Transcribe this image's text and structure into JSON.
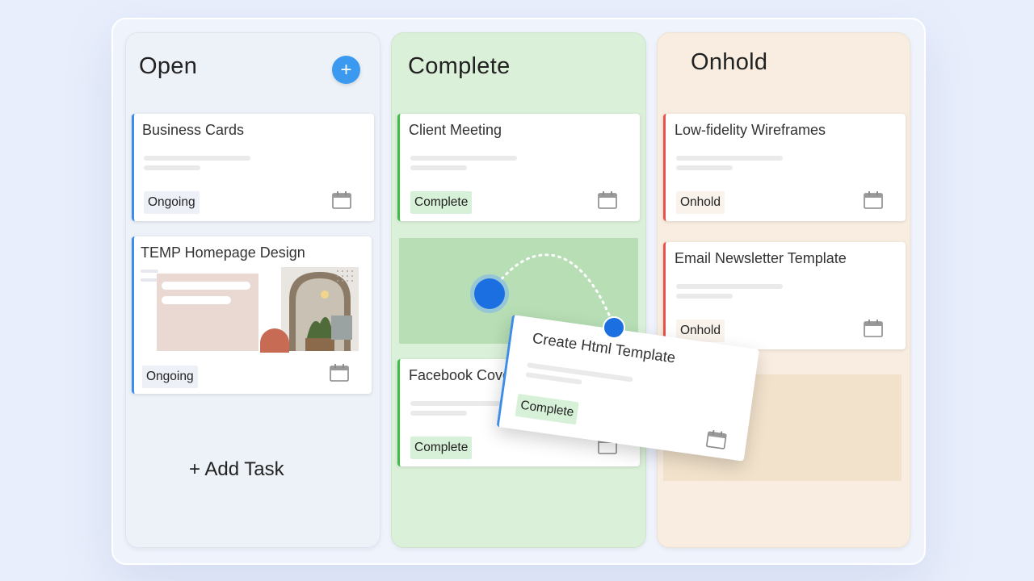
{
  "columns": {
    "open": {
      "title": "Open",
      "add_icon": "plus-icon",
      "add_task_label": "+ Add Task"
    },
    "complete": {
      "title": "Complete"
    },
    "onhold": {
      "title": "Onhold"
    }
  },
  "cards": {
    "business_cards": {
      "title": "Business Cards",
      "status": "Ongoing"
    },
    "temp_homepage": {
      "title": "TEMP Homepage Design",
      "status": "Ongoing"
    },
    "client_meeting": {
      "title": "Client Meeting",
      "status": "Complete"
    },
    "facebook_cover": {
      "title": "Facebook Cove",
      "status": "Complete"
    },
    "low_fidelity": {
      "title": "Low-fidelity Wireframes",
      "status": "Onhold"
    },
    "email_newsletter": {
      "title": "Email Newsletter Template",
      "status": "Onhold"
    }
  },
  "dragging_card": {
    "title": "Create Html Template",
    "status": "Complete"
  },
  "colors": {
    "open_accent": "#3b8de9",
    "complete_accent": "#3dbd46",
    "onhold_accent": "#e8534b",
    "add_button": "#3b9af0"
  },
  "icons": {
    "calendar": "calendar-icon",
    "plus": "plus-icon"
  }
}
